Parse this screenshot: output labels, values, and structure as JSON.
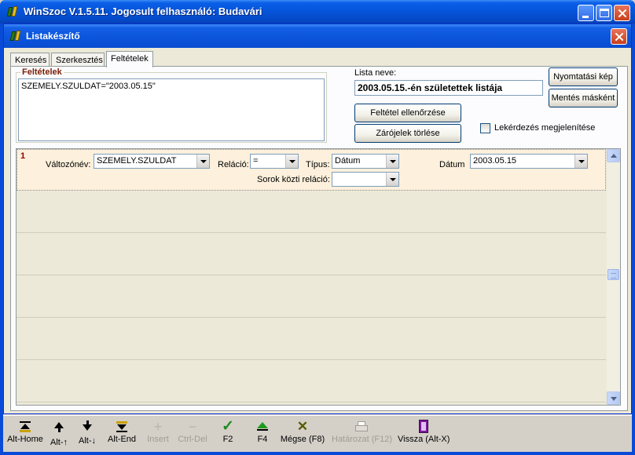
{
  "app_window": {
    "title": "WinSzoc V.1.5.11.  Jogosult felhasználó: Budavári"
  },
  "child_window": {
    "title": "Listakészítő"
  },
  "tabs": [
    {
      "label": "Keresés",
      "active": false
    },
    {
      "label": "Szerkesztés",
      "active": false
    },
    {
      "label": "Feltételek",
      "active": true
    }
  ],
  "conditions": {
    "legend": "Feltételek",
    "text": "SZEMELY.SZULDAT=\"2003.05.15\""
  },
  "list_name": {
    "label": "Lista neve:",
    "value": "2003.05.15.-én születettek listája"
  },
  "buttons": {
    "print_image": "Nyomtatási kép",
    "save_as": "Mentés másként",
    "check_condition": "Feltétel ellenőrzése",
    "clear_parens": "Zárójelek törlése"
  },
  "show_query": {
    "label": "Lekérdezés megjelenítése",
    "checked": false
  },
  "condition_row": {
    "number": "1",
    "variable_label": "Változónév:",
    "variable_value": "SZEMELY.SZULDAT",
    "relation_label": "Reláció:",
    "relation_value": "=",
    "type_label": "Típus:",
    "type_value": "Dátum",
    "date_label": "Dátum",
    "date_value": "2003.05.15",
    "row_relation_label": "Sorok közti reláció:",
    "row_relation_value": ""
  },
  "toolbar": {
    "items": [
      {
        "label": "Alt-Home",
        "icon": "first-record-icon",
        "enabled": true
      },
      {
        "label": "Alt-↑",
        "icon": "arrow-up-icon",
        "enabled": true
      },
      {
        "label": "Alt-↓",
        "icon": "arrow-down-icon",
        "enabled": true
      },
      {
        "label": "Alt-End",
        "icon": "last-record-icon",
        "enabled": true
      },
      {
        "label": "Insert",
        "icon": "plus-icon",
        "enabled": false
      },
      {
        "label": "Ctrl-Del",
        "icon": "minus-icon",
        "enabled": false
      },
      {
        "label": "F2",
        "icon": "checkmark-icon",
        "enabled": true
      },
      {
        "label": "F4",
        "icon": "triangle-up-icon",
        "enabled": true
      },
      {
        "label": "Mégse (F8)",
        "icon": "cancel-x-icon",
        "enabled": true
      },
      {
        "label": "Határozat (F12)",
        "icon": "printer-icon",
        "enabled": false
      },
      {
        "label": "Vissza (Alt-X)",
        "icon": "exit-door-icon",
        "enabled": true
      }
    ]
  },
  "colors": {
    "title_blue": "#0b55dc",
    "legend_red": "#7a1c04",
    "row_highlight": "#fdf0dc"
  }
}
